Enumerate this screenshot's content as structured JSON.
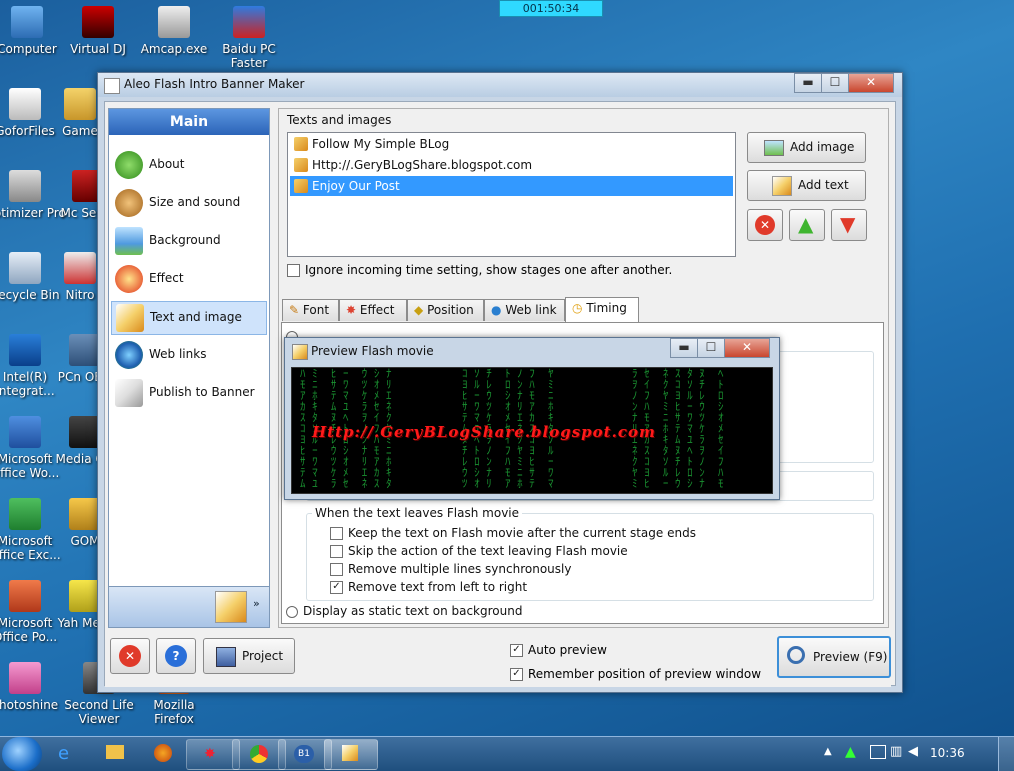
{
  "timer": "001:50:34",
  "desktop_icons": [
    {
      "label": "Computer"
    },
    {
      "label": "Virtual DJ"
    },
    {
      "label": "Amcap.exe"
    },
    {
      "label": "Baidu PC Faster"
    },
    {
      "label": "GoforFiles"
    },
    {
      "label": "Game"
    },
    {
      "label": "Optimizer Pro"
    },
    {
      "label": "Mc Secur"
    },
    {
      "label": "Recycle Bin"
    },
    {
      "label": "Nitro"
    },
    {
      "label": "Intel(R) Integrat..."
    },
    {
      "label": "PCn OEM"
    },
    {
      "label": "Microsoft Office Wo..."
    },
    {
      "label": "Media Cla"
    },
    {
      "label": "Microsoft Office Exc..."
    },
    {
      "label": "GOM"
    },
    {
      "label": "Microsoft Office Po..."
    },
    {
      "label": "Yah Mess"
    },
    {
      "label": "Photoshine"
    },
    {
      "label": "Second Life Viewer"
    },
    {
      "label": "Mozilla Firefox"
    }
  ],
  "window": {
    "title": "Aleo Flash Intro Banner Maker",
    "min": "▬",
    "max": "☐",
    "close": "✕"
  },
  "left_panel": {
    "header": "Main",
    "items": [
      {
        "label": "About",
        "icon": "home-icon"
      },
      {
        "label": "Size and sound",
        "icon": "cookie-icon"
      },
      {
        "label": "Background",
        "icon": "picture-icon"
      },
      {
        "label": "Effect",
        "icon": "burst-icon"
      },
      {
        "label": "Text and image",
        "icon": "pencil-icon"
      },
      {
        "label": "Web links",
        "icon": "globe-icon"
      },
      {
        "label": "Publish to Banner",
        "icon": "publish-icon"
      }
    ],
    "selected": "Text and image"
  },
  "texts_images": {
    "group_title": "Texts and images",
    "items": [
      {
        "text": "Follow My Simple BLog"
      },
      {
        "text": "Http://.GeryBLogShare.blogspot.com"
      },
      {
        "text": "Enjoy Our Post"
      }
    ],
    "selected_index": 2,
    "add_image": "Add image",
    "add_text": "Add text",
    "ignore_label": "Ignore incoming time setting, show stages one after another."
  },
  "tabs": [
    "Font",
    "Effect",
    "Position",
    "Web link",
    "Timing"
  ],
  "active_tab": "Timing",
  "timing": {
    "leave_group_title": "When the text leaves Flash movie",
    "options": [
      {
        "label": "Keep the text on Flash movie after the current stage ends",
        "checked": false
      },
      {
        "label": "Skip the action of the text leaving Flash movie",
        "checked": false
      },
      {
        "label": "Remove multiple lines synchronously",
        "checked": false
      },
      {
        "label": "Remove text from left to right",
        "checked": true
      }
    ],
    "static_radio": "Display as static text on background"
  },
  "preview_window": {
    "title": "Preview Flash movie",
    "flash_text": "Http://.GeryBLogShare.blogspot.com"
  },
  "bottom": {
    "project_label": "Project",
    "auto_preview": "Auto preview",
    "remember_position": "Remember position of preview window",
    "preview_button": "Preview (F9)"
  },
  "taskbar": {
    "clock": "10:36"
  }
}
